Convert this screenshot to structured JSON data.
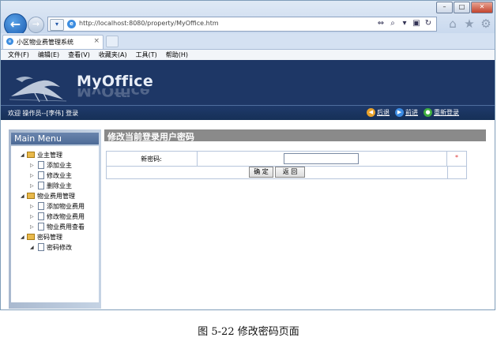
{
  "browser": {
    "url": "http://localhost:8080/property/MyOffice.htm",
    "tab_title": "小区物业费管理系统",
    "tab_close": "×",
    "back_glyph": "←",
    "forward_glyph": "→",
    "window_buttons": {
      "minimize": "–",
      "maximize": "□",
      "close": "✕"
    }
  },
  "menu": [
    "文件(F)",
    "编辑(E)",
    "查看(V)",
    "收藏夹(A)",
    "工具(T)",
    "帮助(H)"
  ],
  "header": {
    "brand": "MyOffice",
    "welcome": "欢迎 操作员--[李伟] 登录",
    "nav": [
      {
        "label": "后退",
        "icon": "back-circle-icon",
        "color": "#e8a22b"
      },
      {
        "label": "前进",
        "icon": "forward-circle-icon",
        "color": "#3b8be3"
      },
      {
        "label": "重新登录",
        "icon": "relogin-icon",
        "color": "#3fae3f"
      }
    ]
  },
  "sidebar": {
    "title": "Main Menu",
    "groups": [
      {
        "label": "业主管理",
        "items": [
          "添加业主",
          "修改业主",
          "删除业主"
        ]
      },
      {
        "label": "物业费用管理",
        "items": [
          "添加物业费用",
          "修改物业费用",
          "物业费用查看"
        ]
      },
      {
        "label": "密码管理",
        "items": [
          "密码修改"
        ]
      }
    ]
  },
  "main": {
    "title": "修改当前登录用户密码",
    "field_label": "新密码:",
    "field_value": "",
    "required_mark": "*",
    "confirm_label": "确 定",
    "back_label": "返 回"
  },
  "caption": "图 5-22  修改密码页面"
}
